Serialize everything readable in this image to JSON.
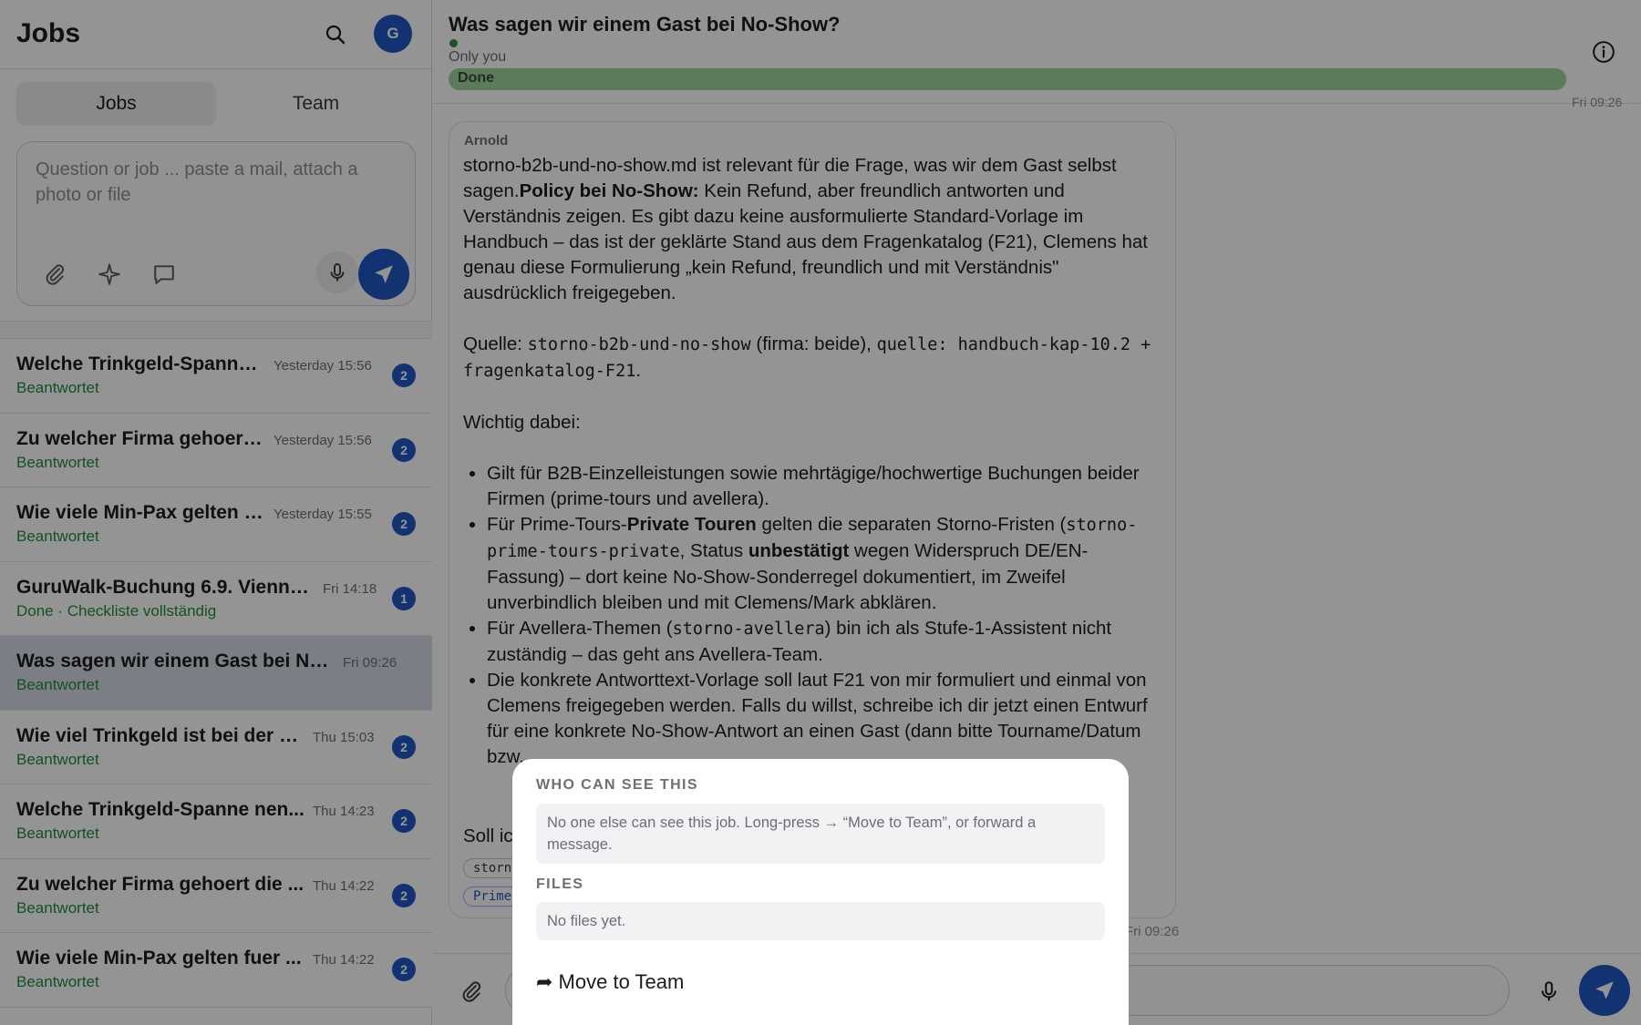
{
  "sidebar": {
    "title": "Jobs",
    "avatar_initial": "G",
    "tabs": [
      {
        "label": "Jobs",
        "active": true
      },
      {
        "label": "Team",
        "active": false
      }
    ],
    "composer_placeholder": "Question or job ... paste a mail, attach a photo or file",
    "jobs": [
      {
        "title": "Welche Trinkgeld-Spanne ...",
        "time": "Yesterday 15:56",
        "subtitle": "Beantwortet",
        "badge": "2"
      },
      {
        "title": "Zu welcher Firma gehoert ...",
        "time": "Yesterday 15:56",
        "subtitle": "Beantwortet",
        "badge": "2"
      },
      {
        "title": "Wie viele Min-Pax gelten f...",
        "time": "Yesterday 15:55",
        "subtitle": "Beantwortet",
        "badge": "2"
      },
      {
        "title": "GuruWalk-Buchung 6.9. Vienna ...",
        "time": "Fri 14:18",
        "subtitle": "Done · Checkliste vollständig",
        "badge": "1"
      },
      {
        "title": "Was sagen wir einem Gast bei No-...",
        "time": "Fri 09:26",
        "subtitle": "Beantwortet",
        "badge": "",
        "selected": true
      },
      {
        "title": "Wie viel Trinkgeld ist bei der Fr...",
        "time": "Thu 15:03",
        "subtitle": "Beantwortet",
        "badge": "2"
      },
      {
        "title": "Welche Trinkgeld-Spanne nen...",
        "time": "Thu 14:23",
        "subtitle": "Beantwortet",
        "badge": "2"
      },
      {
        "title": "Zu welcher Firma gehoert die ...",
        "time": "Thu 14:22",
        "subtitle": "Beantwortet",
        "badge": "2"
      },
      {
        "title": "Wie viele Min-Pax gelten fuer ...",
        "time": "Thu 14:22",
        "subtitle": "Beantwortet",
        "badge": "2"
      }
    ]
  },
  "chat": {
    "title": "Was sagen wir einem Gast bei No-Show?",
    "visibility": "Only you",
    "status_label": "Done",
    "progress_fraction": 1.0,
    "top_time": "Fri 09:26",
    "message": {
      "author": "Arnold",
      "p1_a": "storno-b2b-und-no-show.md ist relevant für die Frage, was wir dem Gast selbst sagen.",
      "p1_bold": "Policy bei No-Show:",
      "p1_b": " Kein Refund, aber freundlich antworten und Verständnis zeigen. Es gibt dazu keine ausformulierte Standard-Vorlage im Handbuch – das ist der geklärte Stand aus dem Fragenkatalog (F21), Clemens hat genau diese Formulierung „kein Refund, freundlich und mit Verständnis\" ausdrücklich freigegeben.",
      "q_label": "Quelle: ",
      "q_code1": "storno-b2b-und-no-show",
      "q_mid": " (firma: beide), ",
      "q_code2": "quelle: handbuch-kap-10.2 + fragenkatalog-F21",
      "q_end": ".",
      "wichtig": "Wichtig dabei:",
      "b1": "Gilt für B2B-Einzelleistungen sowie mehrtägige/hochwertige Buchungen beider Firmen (prime-tours und avellera).",
      "b2_a": "Für Prime-Tours-",
      "b2_bold": "Private Touren",
      "b2_b": " gelten die separaten Storno-Fristen (",
      "b2_code": "storno-prime-tours-private",
      "b2_c": ", Status ",
      "b2_bold2": "unbestätigt",
      "b2_d": " wegen Widerspruch DE/EN-Fassung) – dort keine No-Show-Sonderregel dokumentiert, im Zweifel unverbindlich bleiben und mit Clemens/Mark abklären.",
      "b3_a": "Für Avellera-Themen (",
      "b3_code": "storno-avellera",
      "b3_b": ") bin ich als Stufe-1-Assistent nicht zuständig – das geht ans Avellera-Team.",
      "b4": "Die konkrete Antworttext-Vorlage soll laut F21 von mir formuliert und einmal von Clemens freigegeben werden. Falls du willst, schreibe ich dir jetzt einen Entwurf für eine konkrete No-Show-Antwort an einen Gast (dann bitte Tourname/Datum bzw. ...",
      "closing": "Soll ich ...",
      "tag1": "storno-b2b-und-no-show",
      "tag2": "Prime-Tours",
      "time": "Fri 09:26"
    }
  },
  "sheet": {
    "who_heading": "WHO CAN SEE THIS",
    "who_text": "No one else can see this job. Long-press → “Move to Team”, or forward a message.",
    "files_heading": "FILES",
    "files_text": "No files yet.",
    "move_label": "➦ Move to Team"
  },
  "colors": {
    "accent": "#1f57c3",
    "answered": "#248a3d",
    "done_bar": "#b8ddb8"
  }
}
